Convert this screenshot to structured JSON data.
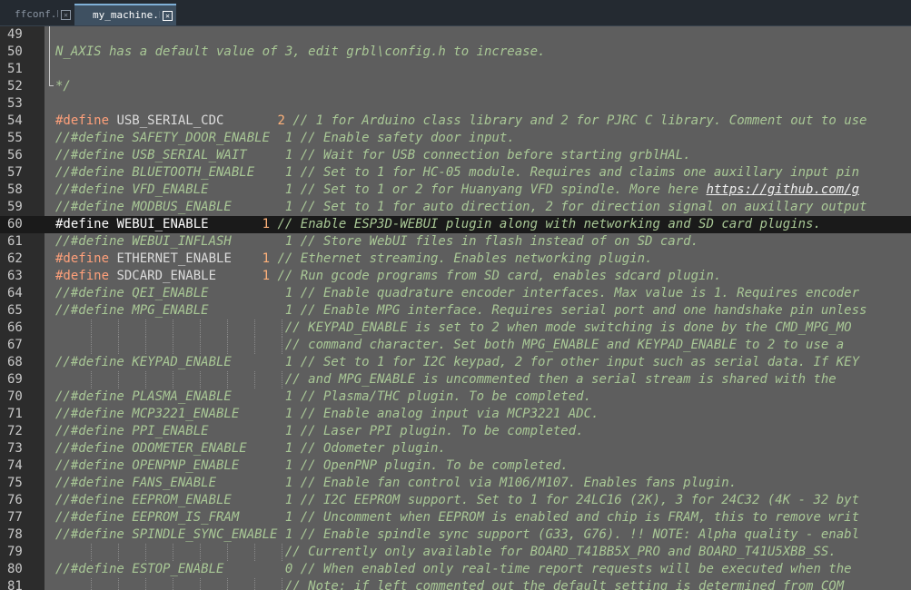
{
  "tabs": [
    {
      "label": "ffconf.h",
      "active": false
    },
    {
      "label": "my_machine.h",
      "active": true
    }
  ],
  "editor": {
    "current_line": 60,
    "lines": [
      {
        "n": "49",
        "kind": "blank"
      },
      {
        "n": "50",
        "kind": "comment",
        "text": "N_AXIS has a default value of 3, edit grbl\\config.h to increase."
      },
      {
        "n": "51",
        "kind": "blank"
      },
      {
        "n": "52",
        "kind": "comment",
        "text": "*/"
      },
      {
        "n": "53",
        "kind": "blank"
      },
      {
        "n": "54",
        "kind": "define",
        "dir": "#define",
        "name": "USB_SERIAL_CDC      ",
        "val": "2",
        "comment": " // 1 for Arduino class library and 2 for PJRC C library. Comment out to use"
      },
      {
        "n": "55",
        "kind": "cdefine",
        "text": "//#define SAFETY_DOOR_ENABLE  1 // Enable safety door input."
      },
      {
        "n": "56",
        "kind": "cdefine",
        "text": "//#define USB_SERIAL_WAIT     1 // Wait for USB connection before starting grblHAL."
      },
      {
        "n": "57",
        "kind": "cdefine",
        "text": "//#define BLUETOOTH_ENABLE    1 // Set to 1 for HC-05 module. Requires and claims one auxillary input pin"
      },
      {
        "n": "58",
        "kind": "cdefine",
        "text": "//#define VFD_ENABLE          1 // Set to 1 or 2 for Huanyang VFD spindle. More here ",
        "link": "https://github.com/g"
      },
      {
        "n": "59",
        "kind": "cdefine",
        "text": "//#define MODBUS_ENABLE       1 // Set to 1 for auto direction, 2 for direction signal on auxillary output"
      },
      {
        "n": "60",
        "kind": "define",
        "dir": "#define",
        "name": "WEBUI_ENABLE      ",
        "val": "1",
        "comment": " // Enable ESP3D-WEBUI plugin along with networking and SD card plugins."
      },
      {
        "n": "61",
        "kind": "cdefine",
        "text": "//#define WEBUI_INFLASH       1 // Store WebUI files in flash instead of on SD card."
      },
      {
        "n": "62",
        "kind": "define",
        "dir": "#define",
        "name": "ETHERNET_ENABLE   ",
        "val": "1",
        "comment": " // Ethernet streaming. Enables networking plugin."
      },
      {
        "n": "63",
        "kind": "define",
        "dir": "#define",
        "name": "SDCARD_ENABLE     ",
        "val": "1",
        "comment": " // Run gcode programs from SD card, enables sdcard plugin."
      },
      {
        "n": "64",
        "kind": "cdefine",
        "text": "//#define QEI_ENABLE          1 // Enable quadrature encoder interfaces. Max value is 1. Requires encoder"
      },
      {
        "n": "65",
        "kind": "cdefine",
        "text": "//#define MPG_ENABLE          1 // Enable MPG interface. Requires serial port and one handshake pin unless"
      },
      {
        "n": "66",
        "kind": "cont",
        "text": "                              // KEYPAD_ENABLE is set to 2 when mode switching is done by the CMD_MPG_MO"
      },
      {
        "n": "67",
        "kind": "cont",
        "text": "                              // command character. Set both MPG_ENABLE and KEYPAD_ENABLE to 2 to use a"
      },
      {
        "n": "68",
        "kind": "cdefine",
        "text": "//#define KEYPAD_ENABLE       1 // Set to 1 for I2C keypad, 2 for other input such as serial data. If KEY"
      },
      {
        "n": "69",
        "kind": "cont",
        "text": "                              // and MPG_ENABLE is uncommented then a serial stream is shared with the"
      },
      {
        "n": "70",
        "kind": "cdefine",
        "text": "//#define PLASMA_ENABLE       1 // Plasma/THC plugin. To be completed."
      },
      {
        "n": "71",
        "kind": "cdefine",
        "text": "//#define MCP3221_ENABLE      1 // Enable analog input via MCP3221 ADC."
      },
      {
        "n": "72",
        "kind": "cdefine",
        "text": "//#define PPI_ENABLE          1 // Laser PPI plugin. To be completed."
      },
      {
        "n": "73",
        "kind": "cdefine",
        "text": "//#define ODOMETER_ENABLE     1 // Odometer plugin."
      },
      {
        "n": "74",
        "kind": "cdefine",
        "text": "//#define OPENPNP_ENABLE      1 // OpenPNP plugin. To be completed."
      },
      {
        "n": "75",
        "kind": "cdefine",
        "text": "//#define FANS_ENABLE         1 // Enable fan control via M106/M107. Enables fans plugin."
      },
      {
        "n": "76",
        "kind": "cdefine",
        "text": "//#define EEPROM_ENABLE       1 // I2C EEPROM support. Set to 1 for 24LC16 (2K), 3 for 24C32 (4K - 32 byt"
      },
      {
        "n": "77",
        "kind": "cdefine",
        "text": "//#define EEPROM_IS_FRAM      1 // Uncomment when EEPROM is enabled and chip is FRAM, this to remove writ"
      },
      {
        "n": "78",
        "kind": "cdefine",
        "text": "//#define SPINDLE_SYNC_ENABLE 1 // Enable spindle sync support (G33, G76). !! NOTE: Alpha quality - enabl"
      },
      {
        "n": "79",
        "kind": "cont",
        "text": "                              // Currently only available for BOARD_T41BB5X_PRO and BOARD_T41U5XBB_SS."
      },
      {
        "n": "80",
        "kind": "cdefine",
        "text": "//#define ESTOP_ENABLE        0 // When enabled only real-time report requests will be executed when the"
      },
      {
        "n": "81",
        "kind": "cont",
        "text": "                              // Note: if left commented out the default setting is determined from COM"
      }
    ]
  },
  "colors": {
    "editor_bg": "#5e5e5e",
    "gutter_bg": "#2c2c2c",
    "current_line_bg": "#1a1a1a",
    "comment": "#a9c896",
    "directive": "#ffa07a",
    "number": "#ffb27a"
  }
}
